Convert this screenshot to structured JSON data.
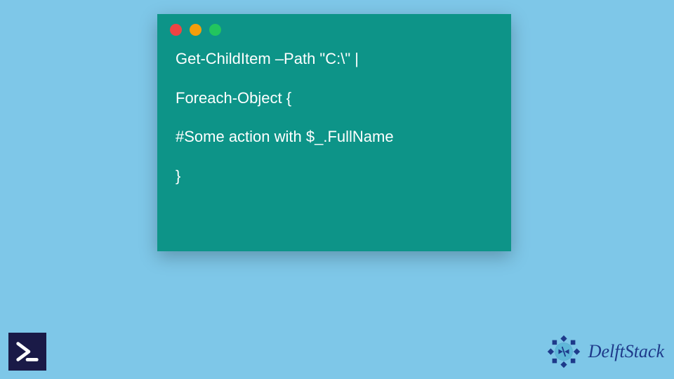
{
  "code": {
    "line1": "Get-ChildItem –Path \"C:\\\" |",
    "line2": "Foreach-Object {",
    "line3": "#Some action with $_.FullName",
    "line4": "}"
  },
  "brand": {
    "name": "DelftStack"
  },
  "colors": {
    "background": "#7ec7e8",
    "window": "#0d9488",
    "ps_icon_bg": "#1a1a47",
    "brand_text": "#1e3a8a"
  }
}
